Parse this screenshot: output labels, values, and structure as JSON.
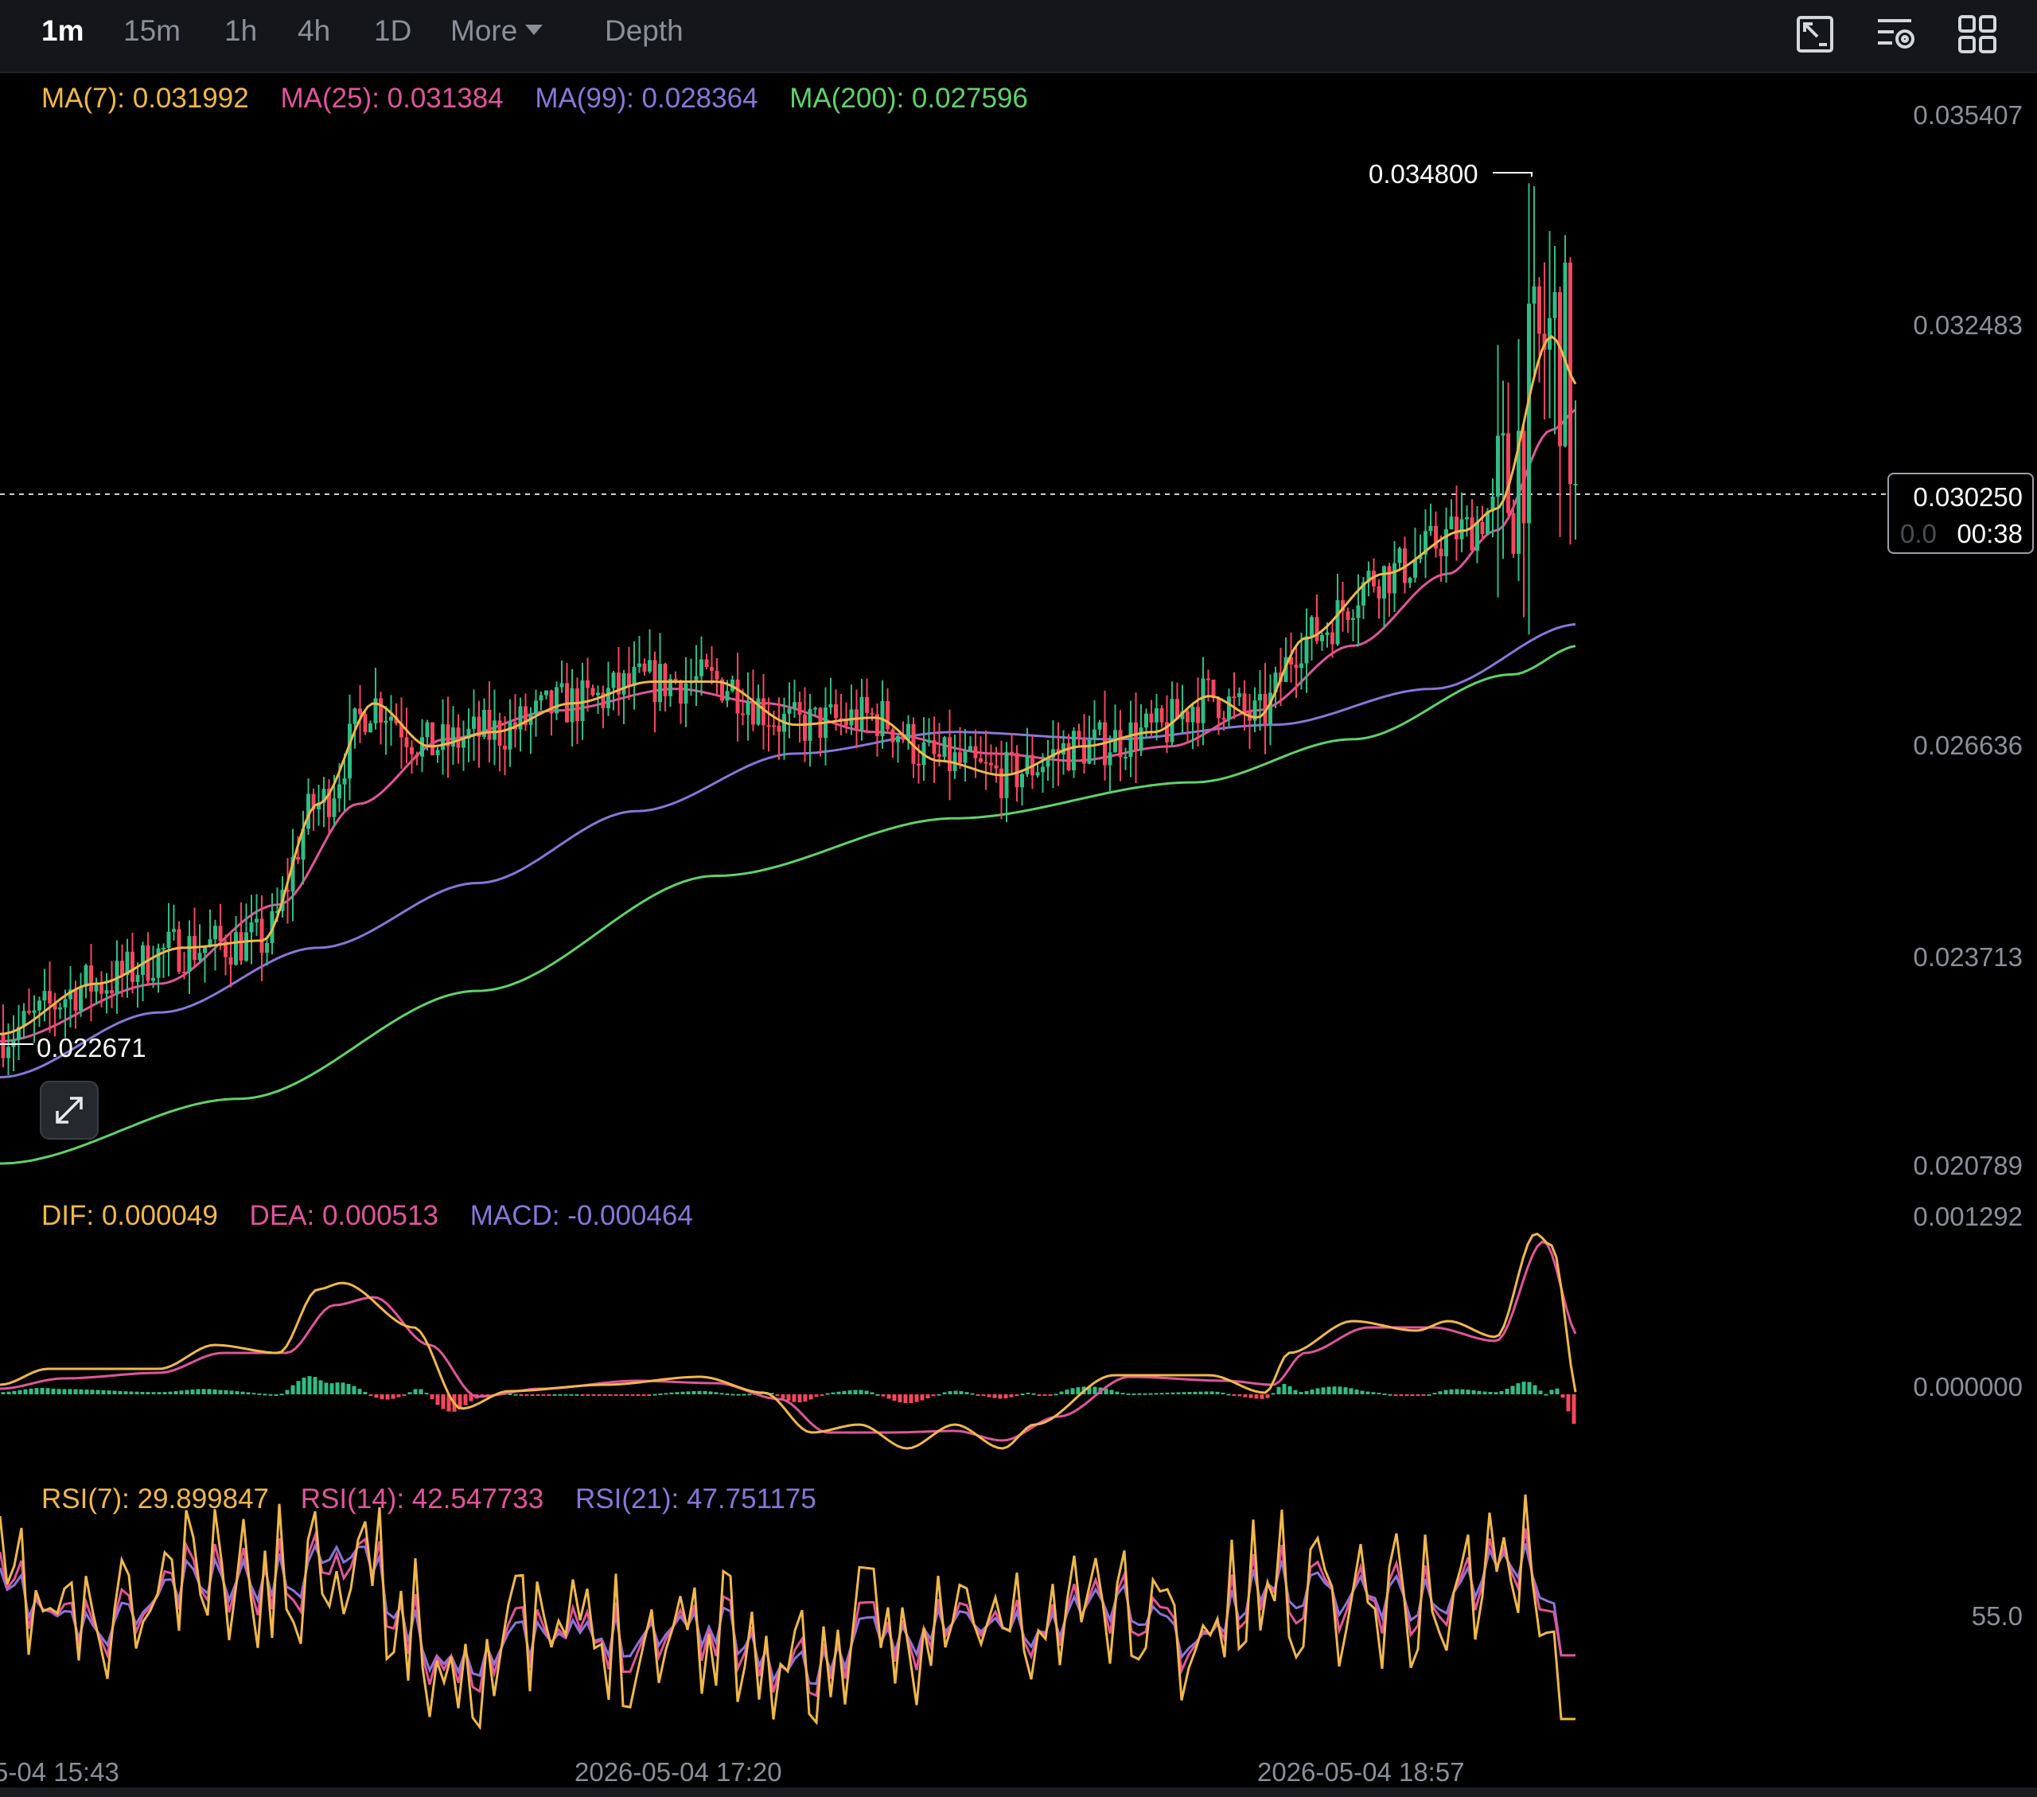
{
  "toolbar": {
    "tabs": [
      {
        "label": "1m",
        "active": true
      },
      {
        "label": "15m",
        "active": false
      },
      {
        "label": "1h",
        "active": false
      },
      {
        "label": "4h",
        "active": false
      },
      {
        "label": "1D",
        "active": false
      },
      {
        "label": "More",
        "active": false
      },
      {
        "label": "Depth",
        "active": false
      }
    ],
    "icons": [
      "drawing-tools-icon",
      "indicator-settings-icon",
      "grid-layout-icon"
    ]
  },
  "ma_legend": {
    "ma7": "MA(7): 0.031992",
    "ma25": "MA(25): 0.031384",
    "ma99": "MA(99): 0.028364",
    "ma200": "MA(200): 0.027596"
  },
  "macd_legend": {
    "dif": "DIF: 0.000049",
    "dea": "DEA: 0.000513",
    "macd": "MACD: -0.000464"
  },
  "rsi_legend": {
    "rsi7": "RSI(7): 29.899847",
    "rsi14": "RSI(14): 42.547733",
    "rsi21": "RSI(21): 47.751175"
  },
  "price_axis": [
    "0.035407",
    "0.032483",
    "0.026636",
    "0.023713",
    "0.020789"
  ],
  "macd_axis": [
    "0.001292",
    "0.000000"
  ],
  "rsi_axis": [
    "55.0"
  ],
  "time_axis": [
    "5-04 15:43",
    "2026-05-04 17:20",
    "2026-05-04 18:57"
  ],
  "markers": {
    "high": "0.034800",
    "low": "0.022671"
  },
  "current_price": {
    "price": "0.030250",
    "countdown": "00:38",
    "ghost": "0.0"
  },
  "colors": {
    "ma7": "#f0b84a",
    "ma25": "#e0559b",
    "ma99": "#8a76d8",
    "ma200": "#5fd36a",
    "up": "#2ebd85",
    "down": "#f6465d"
  },
  "chart_data": {
    "type": "line",
    "price_range": [
      0.0198,
      0.0362
    ],
    "high": 0.0348,
    "low": 0.022671,
    "last": 0.03025,
    "ma_last": {
      "ma7": 0.031992,
      "ma25": 0.031384,
      "ma99": 0.028364,
      "ma200": 0.027596
    },
    "rsi_last": {
      "rsi7": 29.899847,
      "rsi14": 42.547733,
      "rsi21": 47.751175
    },
    "macd_last": {
      "dif": 4.9e-05,
      "dea": 0.000513,
      "macd": -0.000464
    }
  }
}
